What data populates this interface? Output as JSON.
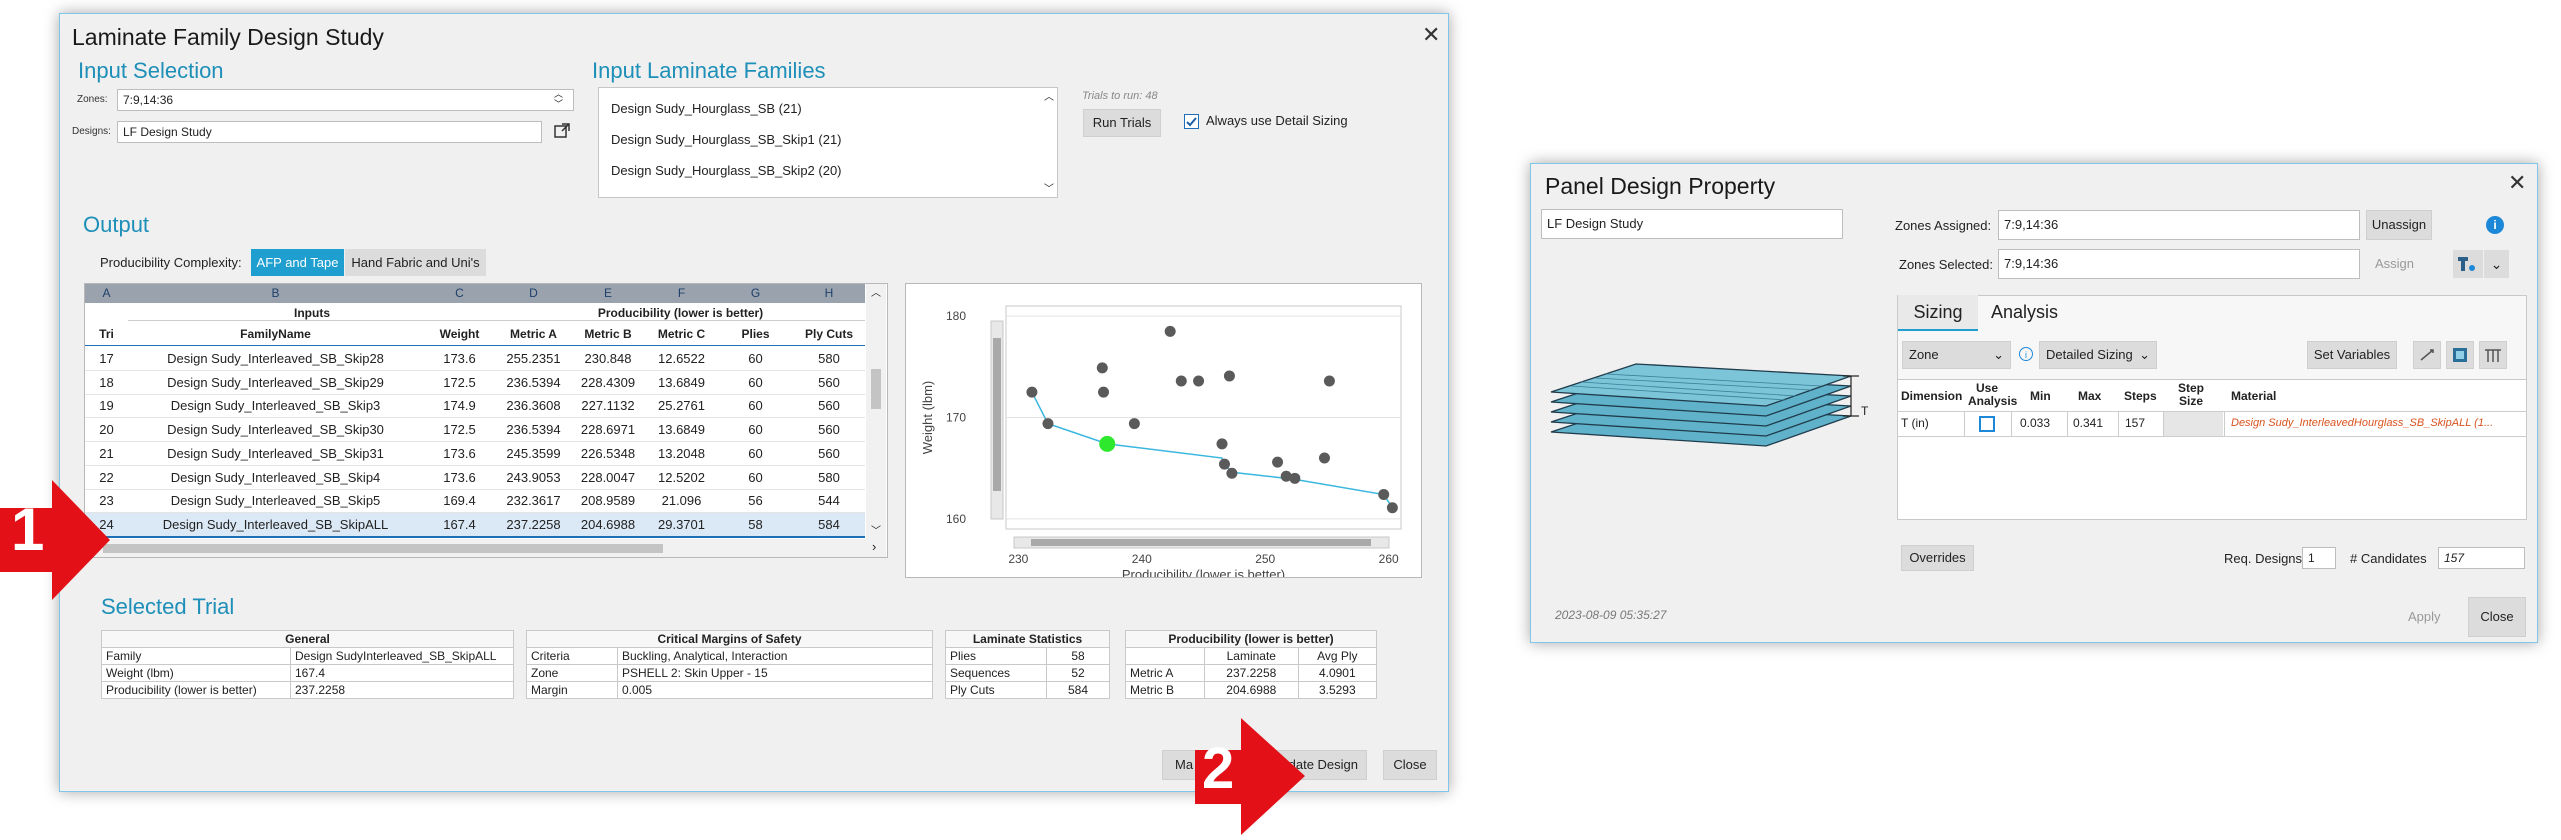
{
  "lf_dialog": {
    "title": "Laminate Family Design Study",
    "input_selection": "Input Selection",
    "zones_label": "Zones:",
    "zones_value": "7:9,14:36",
    "designs_label": "Designs:",
    "designs_value": "LF Design Study",
    "input_families_title": "Input Laminate Families",
    "families": [
      "Design Sudy_Hourglass_SB (21)",
      "Design Sudy_Hourglass_SB_Skip1 (21)",
      "Design Sudy_Hourglass_SB_Skip2 (20)"
    ],
    "trials_to_run": "Trials to run: 48",
    "run_trials": "Run Trials",
    "always_detail": "Always use Detail Sizing",
    "output": "Output",
    "producibility_complexity": "Producibility Complexity:",
    "afp_tab": "AFP and Tape",
    "hand_tab": "Hand Fabric and Uni's",
    "col_letters": [
      "A",
      "B",
      "C",
      "D",
      "E",
      "F",
      "G",
      "H"
    ],
    "group_inputs": "Inputs",
    "group_producibility": "Producibility (lower is better)",
    "col_names": [
      "Tri",
      "FamilyName",
      "Weight",
      "Metric A",
      "Metric B",
      "Metric C",
      "Plies",
      "Ply Cuts"
    ],
    "rows": [
      [
        "17",
        "Design Sudy_Interleaved_SB_Skip28",
        "173.6",
        "255.2351",
        "230.848",
        "12.6522",
        "60",
        "580"
      ],
      [
        "18",
        "Design Sudy_Interleaved_SB_Skip29",
        "172.5",
        "236.5394",
        "228.4309",
        "13.6849",
        "60",
        "560"
      ],
      [
        "19",
        "Design Sudy_Interleaved_SB_Skip3",
        "174.9",
        "236.3608",
        "227.1132",
        "25.2761",
        "60",
        "560"
      ],
      [
        "20",
        "Design Sudy_Interleaved_SB_Skip30",
        "172.5",
        "236.5394",
        "228.6971",
        "13.6849",
        "60",
        "560"
      ],
      [
        "21",
        "Design Sudy_Interleaved_SB_Skip31",
        "173.6",
        "245.3599",
        "226.5348",
        "13.2048",
        "60",
        "560"
      ],
      [
        "22",
        "Design Sudy_Interleaved_SB_Skip4",
        "173.6",
        "243.9053",
        "228.0047",
        "12.5202",
        "60",
        "580"
      ],
      [
        "23",
        "Design Sudy_Interleaved_SB_Skip5",
        "169.4",
        "232.3617",
        "208.9589",
        "21.096",
        "56",
        "544"
      ],
      [
        "24",
        "Design Sudy_Interleaved_SB_SkipALL",
        "167.4",
        "237.2258",
        "204.6988",
        "29.3701",
        "58",
        "584"
      ]
    ],
    "selected_trial_title": "Selected Trial",
    "general": {
      "header": "General",
      "rows": [
        [
          "Family",
          "Design SudyInterleaved_SB_SkipALL"
        ],
        [
          "Weight (lbm)",
          "167.4"
        ],
        [
          "Producibility (lower is better)",
          "237.2258"
        ]
      ]
    },
    "margins": {
      "header": "Critical Margins of Safety",
      "rows": [
        [
          "Criteria",
          "Buckling, Analytical, Interaction"
        ],
        [
          "Zone",
          "PSHELL 2: Skin Upper - 15"
        ],
        [
          "Margin",
          "0.005"
        ]
      ]
    },
    "lam_stats": {
      "header": "Laminate Statistics",
      "rows": [
        [
          "Plies",
          "58"
        ],
        [
          "Sequences",
          "52"
        ],
        [
          "Ply Cuts",
          "584"
        ]
      ]
    },
    "producibility": {
      "header": "Producibility (lower is better)",
      "cols": [
        "Laminate",
        "Avg Ply"
      ],
      "rows": [
        [
          "Metric A",
          "237.2258",
          "4.0901"
        ],
        [
          "Metric B",
          "204.6988",
          "3.5293"
        ]
      ]
    },
    "btn_ma": "Ma",
    "btn_update": "Update Design",
    "btn_close": "Close"
  },
  "chart_data": {
    "type": "scatter",
    "title": "",
    "xlabel": "Producibility (lower is better)",
    "ylabel": "Weight (lbm)",
    "xlim": [
      229,
      261
    ],
    "ylim": [
      159,
      181
    ],
    "xticks": [
      230,
      240,
      250,
      260
    ],
    "yticks": [
      160,
      170,
      180
    ],
    "points": [
      {
        "x": 231.1,
        "y": 172.5
      },
      {
        "x": 232.4,
        "y": 169.4
      },
      {
        "x": 236.8,
        "y": 174.9
      },
      {
        "x": 236.9,
        "y": 172.5
      },
      {
        "x": 239.4,
        "y": 169.4
      },
      {
        "x": 242.3,
        "y": 178.5
      },
      {
        "x": 243.2,
        "y": 173.6
      },
      {
        "x": 244.6,
        "y": 173.6
      },
      {
        "x": 247.1,
        "y": 174.1
      },
      {
        "x": 246.5,
        "y": 167.4
      },
      {
        "x": 246.7,
        "y": 165.4
      },
      {
        "x": 247.3,
        "y": 164.5
      },
      {
        "x": 251.0,
        "y": 165.6
      },
      {
        "x": 251.7,
        "y": 164.2
      },
      {
        "x": 252.4,
        "y": 164.0
      },
      {
        "x": 254.8,
        "y": 166.0
      },
      {
        "x": 255.2,
        "y": 173.6
      },
      {
        "x": 259.6,
        "y": 162.4
      },
      {
        "x": 260.3,
        "y": 161.1
      }
    ],
    "highlight": {
      "x": 237.2,
      "y": 167.4
    },
    "pareto": [
      {
        "x": 231.1,
        "y": 172.5
      },
      {
        "x": 232.4,
        "y": 169.4
      },
      {
        "x": 237.2,
        "y": 167.4
      },
      {
        "x": 246.5,
        "y": 166.0
      },
      {
        "x": 246.7,
        "y": 165.4
      },
      {
        "x": 247.3,
        "y": 164.6
      },
      {
        "x": 251.7,
        "y": 164.0
      },
      {
        "x": 252.4,
        "y": 163.9
      },
      {
        "x": 259.6,
        "y": 162.4
      },
      {
        "x": 260.3,
        "y": 161.1
      }
    ],
    "colors": {
      "points": "#5a5a5a",
      "pareto": "#3ab7df",
      "highlight": "#2ee82e"
    }
  },
  "pd_dialog": {
    "title": "Panel Design Property",
    "name_value": "LF Design Study",
    "zones_assigned_label": "Zones Assigned:",
    "zones_assigned_value": "7:9,14:36",
    "unassign": "Unassign",
    "zones_selected_label": "Zones Selected:",
    "zones_selected_value": "7:9,14:36",
    "assign": "Assign",
    "tab_sizing": "Sizing",
    "tab_analysis": "Analysis",
    "zone_dropdown": "Zone",
    "detail_dropdown": "Detailed Sizing",
    "set_variables": "Set Variables",
    "headers": [
      "Dimension",
      "Use Analysis",
      "Min",
      "Max",
      "Steps",
      "Step Size",
      "Material"
    ],
    "row": {
      "dimension": "T (in)",
      "min": "0.033",
      "max": "0.341",
      "steps": "157",
      "step_size": "",
      "material": "Design Sudy_InterleavedHourglass_SB_SkipALL (1..."
    },
    "overrides": "Overrides",
    "req_designs_label": "Req. Designs",
    "req_designs_value": "1",
    "candidates_label": "# Candidates",
    "candidates_value": "157",
    "timestamp": "2023-08-09 05:35:27",
    "apply": "Apply",
    "close": "Close",
    "t_label": "T"
  },
  "callouts": {
    "one": "1",
    "two": "2",
    "color": "#e31018"
  }
}
